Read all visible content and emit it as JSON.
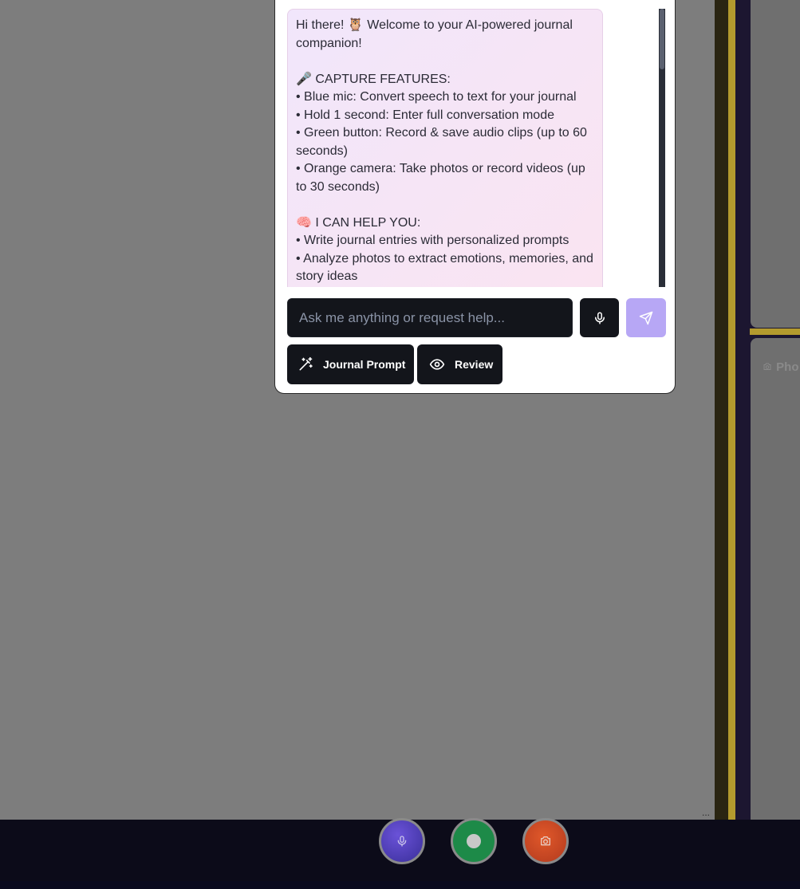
{
  "background": {
    "ellipsis": "...",
    "card_label": "Pho",
    "card_icon": "camera-icon"
  },
  "chat": {
    "message": "Hi there! 🦉 Welcome to your AI-powered journal companion!\n\n🎤 CAPTURE FEATURES:\n• Blue mic: Convert speech to text for your journal\n• Hold 1 second: Enter full conversation mode\n• Green button: Record & save audio clips (up to 60 seconds)\n• Orange camera: Take photos or record videos (up to 30 seconds)\n\n🧠 I CAN HELP YOU:\n• Write journal entries with personalized prompts\n• Analyze photos to extract emotions, memories, and story ideas",
    "input_placeholder": "Ask me anything or request help...",
    "mic_icon": "mic-icon",
    "send_icon": "send-icon",
    "actions": {
      "journal_prompt": "Journal Prompt",
      "review": "Review"
    }
  },
  "bottom_bar": {
    "mic_button_icon": "mic-icon",
    "record_button_icon": "record-dot-icon",
    "camera_button_icon": "camera-icon"
  },
  "colors": {
    "send_button": "#b7a7f5",
    "record_button": "#1d8a48",
    "camera_button": "#d04a22",
    "mic_button": "#4f3fc0",
    "accent_yellow": "#b39a2e"
  }
}
